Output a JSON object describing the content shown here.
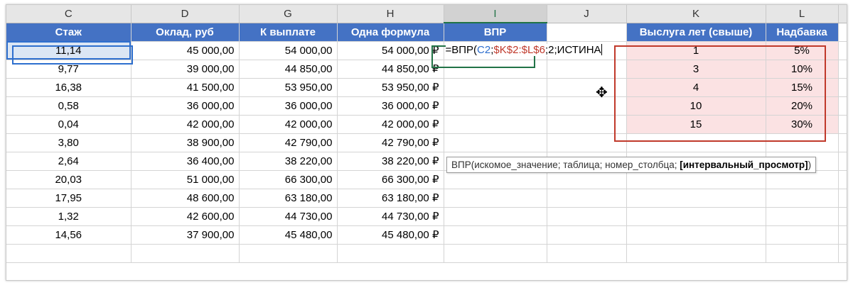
{
  "columns": [
    "C",
    "D",
    "G",
    "H",
    "I",
    "J",
    "K",
    "L"
  ],
  "headers": {
    "c": "Стаж",
    "d": "Оклад, руб",
    "g": "К выплате",
    "h": "Одна формула",
    "i": "ВПР",
    "k": "Выслуга лет (свыше)",
    "l": "Надбавка"
  },
  "rows": [
    {
      "c": "11,14",
      "d": "45 000,00",
      "g": "54 000,00",
      "h": "54 000,00 ₽"
    },
    {
      "c": "9,77",
      "d": "39 000,00",
      "g": "44 850,00",
      "h": "44 850,00 ₽"
    },
    {
      "c": "16,38",
      "d": "41 500,00",
      "g": "53 950,00",
      "h": "53 950,00 ₽"
    },
    {
      "c": "0,58",
      "d": "36 000,00",
      "g": "36 000,00",
      "h": "36 000,00 ₽"
    },
    {
      "c": "0,04",
      "d": "42 000,00",
      "g": "42 000,00",
      "h": "42 000,00 ₽"
    },
    {
      "c": "3,80",
      "d": "38 900,00",
      "g": "42 790,00",
      "h": "42 790,00 ₽"
    },
    {
      "c": "2,64",
      "d": "36 400,00",
      "g": "38 220,00",
      "h": "38 220,00 ₽"
    },
    {
      "c": "20,03",
      "d": "51 000,00",
      "g": "66 300,00",
      "h": "66 300,00 ₽"
    },
    {
      "c": "17,95",
      "d": "48 600,00",
      "g": "63 180,00",
      "h": "63 180,00 ₽"
    },
    {
      "c": "1,32",
      "d": "42 600,00",
      "g": "44 730,00",
      "h": "44 730,00 ₽"
    },
    {
      "c": "14,56",
      "d": "37 900,00",
      "g": "45 480,00",
      "h": "45 480,00 ₽"
    }
  ],
  "lookup": [
    {
      "k": "1",
      "l": "5%"
    },
    {
      "k": "3",
      "l": "10%"
    },
    {
      "k": "4",
      "l": "15%"
    },
    {
      "k": "10",
      "l": "20%"
    },
    {
      "k": "15",
      "l": "30%"
    }
  ],
  "formula": {
    "prefix": "=ВПР(",
    "ref1": "C2",
    "sep1": ";",
    "ref2": "$K$2:$L$6",
    "suffix": ";2;ИСТИНА"
  },
  "tooltip": {
    "text": "ВПР(искомое_значение; таблица; номер_столбца; ",
    "bold": "[интервальный_просмотр]",
    "close": ")"
  },
  "colors": {
    "header_bg": "#4472c4",
    "lookup_bg": "#fbe2e3",
    "ref1": "#2e6fce",
    "ref2": "#c0392b",
    "active_col": "#217346"
  }
}
